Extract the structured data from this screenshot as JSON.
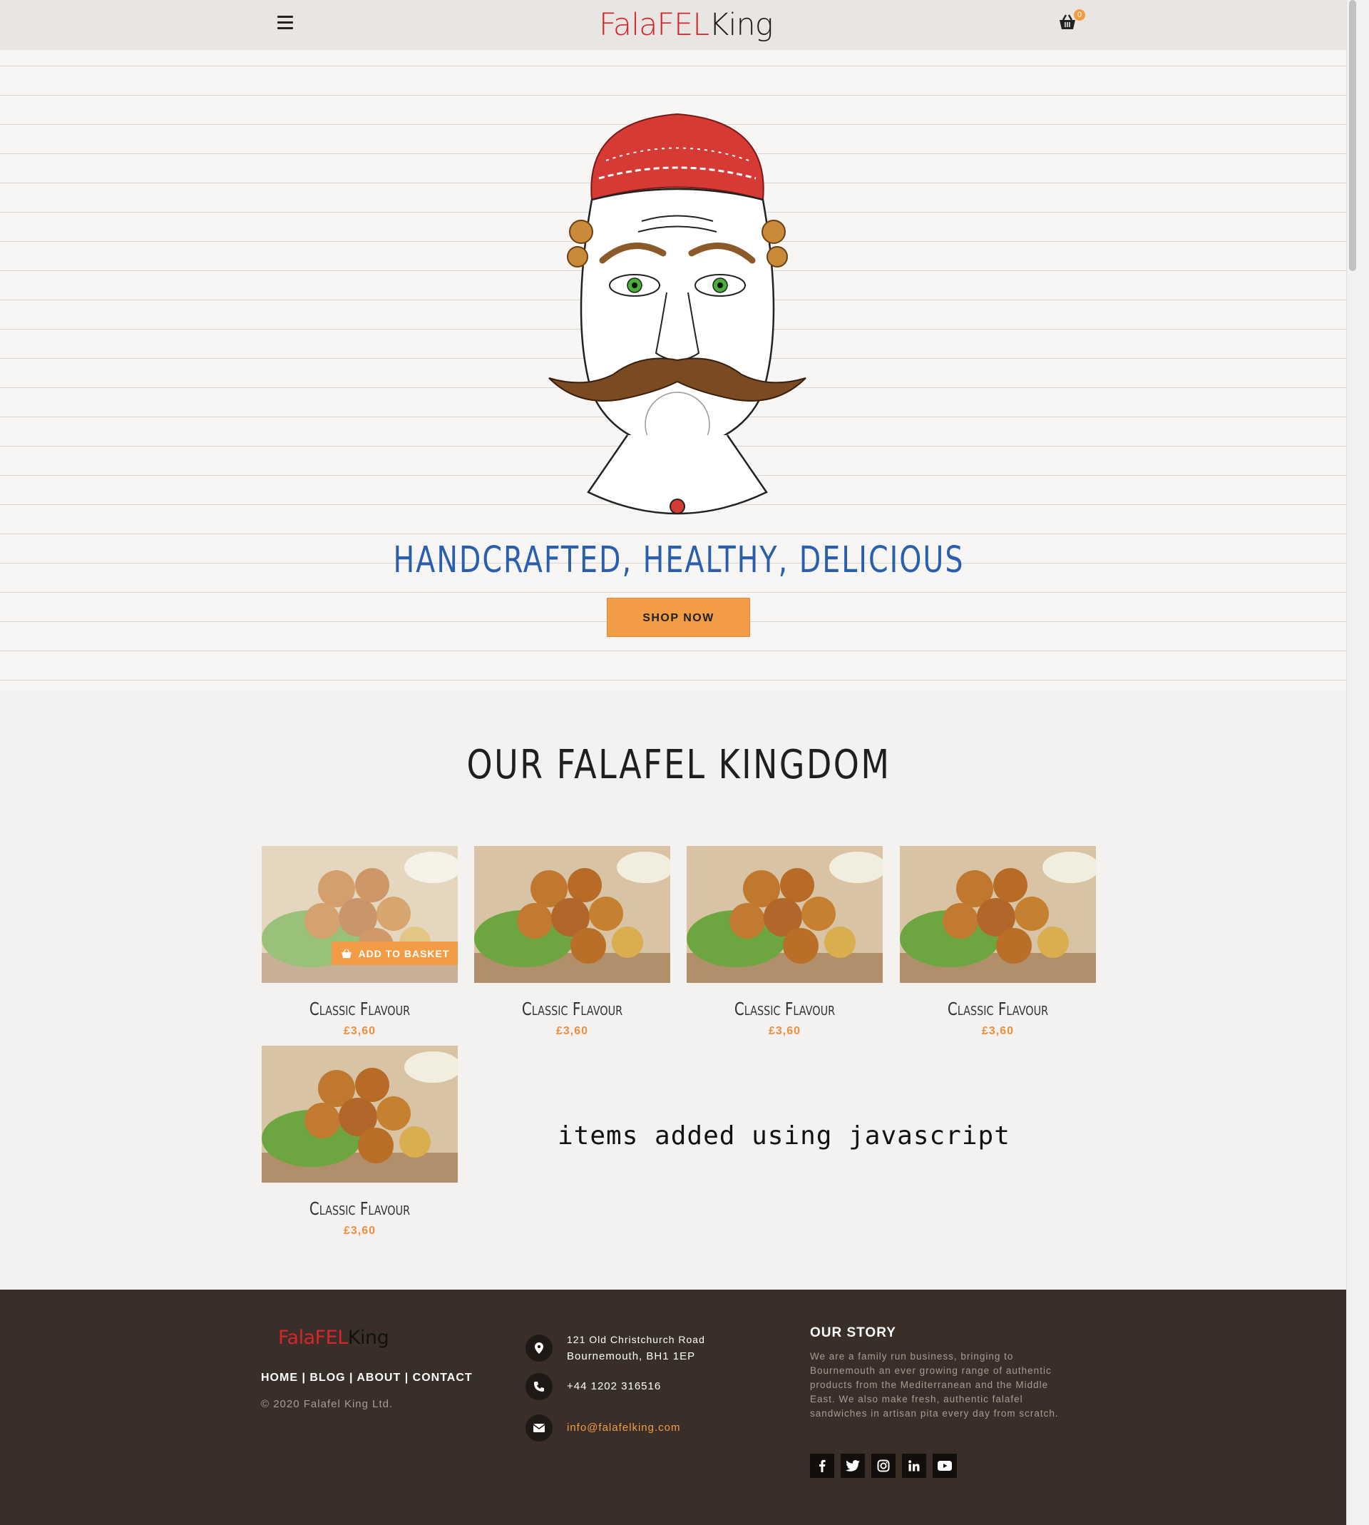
{
  "header": {
    "logo_part1": "FalaFEL",
    "logo_part2": "King",
    "cart_count": "0",
    "menu_icon": "hamburger-icon",
    "cart_icon": "basket-icon"
  },
  "hero": {
    "tagline": "HANDCRAFTED, HEALTHY, DELICIOUS",
    "cta_label": "SHOP NOW"
  },
  "products_section": {
    "title": "OUR FALAFEL KINGDOM",
    "add_to_basket_label": "ADD TO BASKET",
    "items": [
      {
        "name": "Classic Flavour",
        "price": "£3,60"
      },
      {
        "name": "Classic Flavour",
        "price": "£3,60"
      },
      {
        "name": "Classic Flavour",
        "price": "£3,60"
      },
      {
        "name": "Classic Flavour",
        "price": "£3,60"
      },
      {
        "name": "Classic Flavour",
        "price": "£3,60"
      }
    ],
    "note": "items added using javascript"
  },
  "footer": {
    "logo_part1": "FalaFEL",
    "logo_part2": "King",
    "nav": {
      "home": "HOME",
      "blog": "BLOG",
      "about": "ABOUT",
      "contact": "CONTACT",
      "sep": " | "
    },
    "copyright": "© 2020 Falafel King Ltd.",
    "address_line1": "121 Old Christchurch Road",
    "address_line2": "Bournemouth, BH1 1EP",
    "phone": "+44 1202 316516",
    "email": "info@falafelking.com",
    "story_title": "OUR STORY",
    "story_text": "We are a family run business, bringing to Bournemouth an ever growing range of authentic products from the Mediterranean and the Middle East. We also make fresh, authentic falafel sandwiches in artisan pita every day from scratch.",
    "socials": [
      "facebook-icon",
      "twitter-icon",
      "instagram-icon",
      "linkedin-icon",
      "youtube-icon"
    ]
  },
  "colors": {
    "accent": "#f29c46",
    "price": "#ee8e3c",
    "tagline": "#2a5fae",
    "logo_red": "#d6252b",
    "footer_bg": "#3a2f28"
  }
}
